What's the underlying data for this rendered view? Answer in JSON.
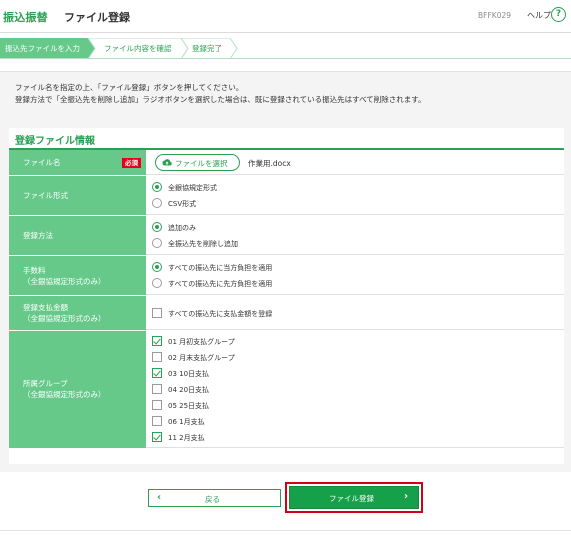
{
  "header": {
    "brand": "振込振替",
    "title": "ファイル登録",
    "screen_id": "BFFK029",
    "help_label": "ヘルプ",
    "help_icon": "?"
  },
  "steps": [
    {
      "label": "振込先ファイルを入力",
      "state": "current"
    },
    {
      "label": "ファイル内容を確認",
      "state": "pending"
    },
    {
      "label": "登録完了",
      "state": "pending"
    }
  ],
  "instructions": [
    "ファイル名を指定の上、「ファイル登録」ボタンを押してください。",
    "登録方法で「全振込先を削除し追加」ラジオボタンを選択した場合は、既に登録されている振込先はすべて削除されます。"
  ],
  "section": {
    "title": "登録ファイル情報"
  },
  "form": {
    "file_name": {
      "label": "ファイル名",
      "required_badge": "必須",
      "select_button": "ファイルを選択",
      "selected_file": "作業用.docx"
    },
    "file_format": {
      "label": "ファイル形式",
      "options": [
        {
          "label": "全銀協規定形式",
          "selected": true
        },
        {
          "label": "CSV形式",
          "selected": false
        }
      ]
    },
    "register_method": {
      "label": "登録方法",
      "options": [
        {
          "label": "追加のみ",
          "selected": true
        },
        {
          "label": "全振込先を削除し追加",
          "selected": false
        }
      ]
    },
    "fee": {
      "label_line1": "手数料",
      "label_line2": "（全銀協規定形式のみ）",
      "options": [
        {
          "label": "すべての振込先に当方負担を適用",
          "selected": true
        },
        {
          "label": "すべての振込先に先方負担を適用",
          "selected": false
        }
      ]
    },
    "payment_amount": {
      "label_line1": "登録支払金額",
      "label_line2": "（全銀協規定形式のみ）",
      "checkbox_label": "すべての振込先に支払金額を登録",
      "checked": false
    },
    "group": {
      "label_line1": "所属グループ",
      "label_line2": "（全銀協規定形式のみ）",
      "items": [
        {
          "label": "01 月初支払グループ",
          "checked": true
        },
        {
          "label": "02 月末支払グループ",
          "checked": false
        },
        {
          "label": "03 10日支払",
          "checked": true
        },
        {
          "label": "04 20日支払",
          "checked": false
        },
        {
          "label": "05 25日支払",
          "checked": false
        },
        {
          "label": "06 1月支払",
          "checked": false
        },
        {
          "label": "11 2月支払",
          "checked": true
        }
      ]
    }
  },
  "footer": {
    "back_label": "戻る",
    "register_label": "ファイル登録"
  },
  "colors": {
    "brand_green": "#2aa055",
    "label_bg": "#66c98a",
    "button_green": "#16a04a",
    "required_red": "#e5001b",
    "highlight_red": "#d40016"
  }
}
